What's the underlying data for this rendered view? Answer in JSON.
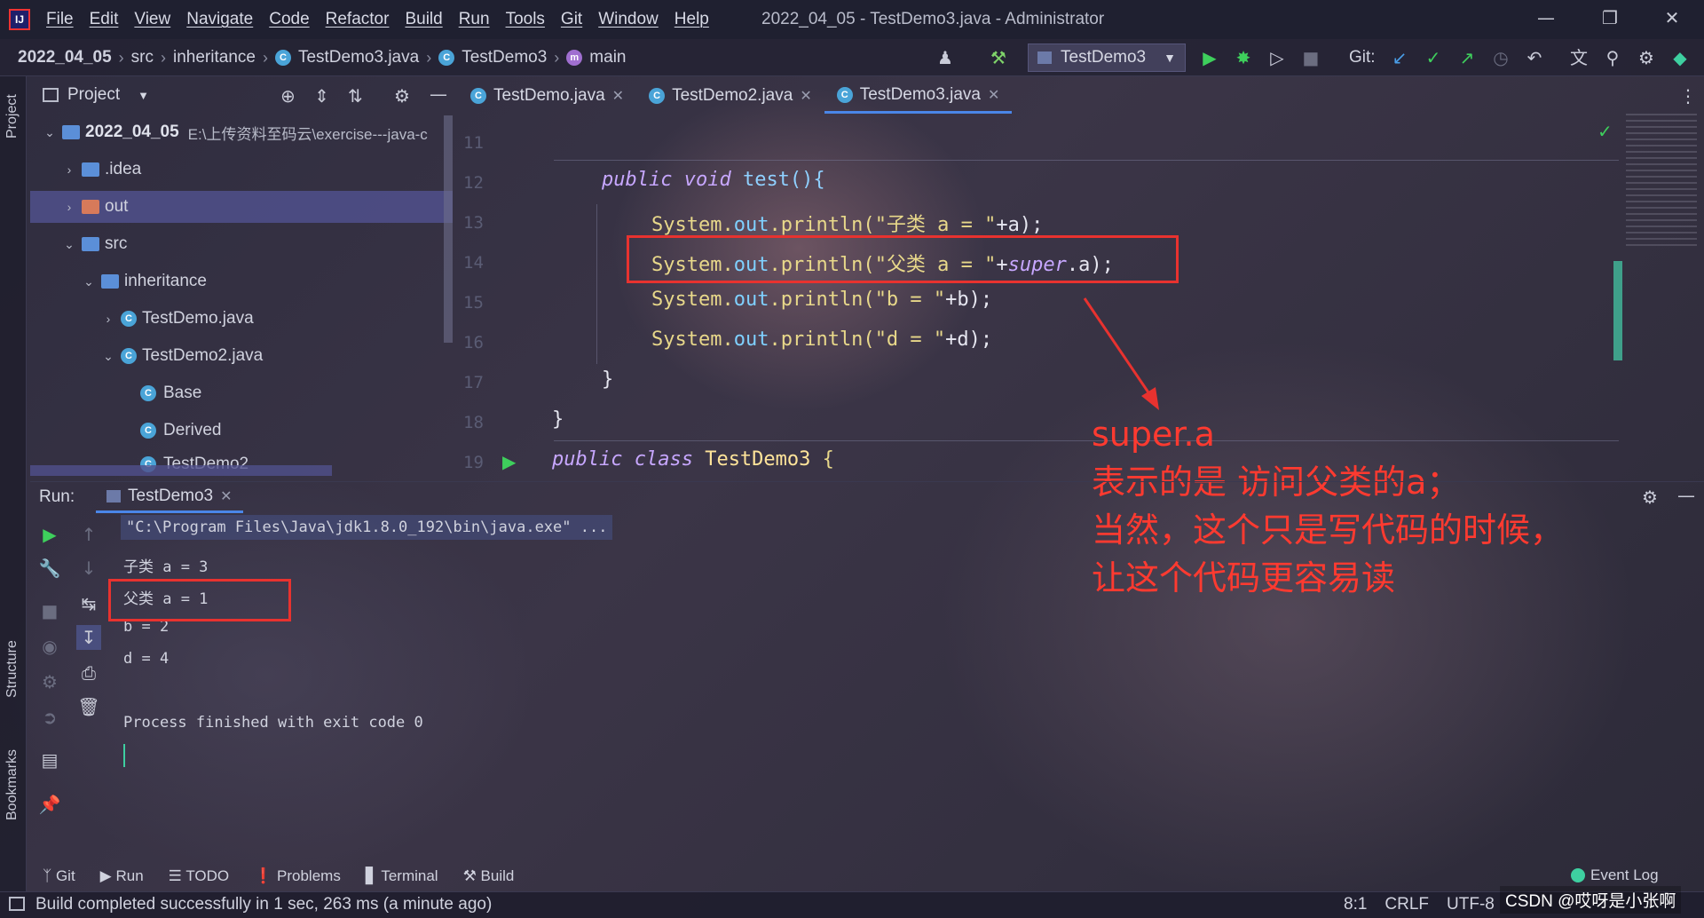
{
  "app": {
    "window_title": "2022_04_05 - TestDemo3.java - Administrator",
    "menu": [
      "File",
      "Edit",
      "View",
      "Navigate",
      "Code",
      "Refactor",
      "Build",
      "Run",
      "Tools",
      "Git",
      "Window",
      "Help"
    ]
  },
  "breadcrumb": [
    "2022_04_05",
    "src",
    "inheritance",
    "TestDemo3.java",
    "TestDemo3",
    "main"
  ],
  "toolbar": {
    "run_config": "TestDemo3",
    "git_label": "Git:"
  },
  "left_stripe": {
    "project": "Project",
    "structure": "Structure",
    "bookmarks": "Bookmarks"
  },
  "project_panel": {
    "title": "Project",
    "tree": [
      {
        "label": "2022_04_05",
        "path": "E:\\上传资料至码云\\exercise---java-c",
        "depth": 0,
        "expanded": true
      },
      {
        "label": ".idea",
        "depth": 1,
        "expanded": false
      },
      {
        "label": "out",
        "depth": 1,
        "expanded": false,
        "selected": true
      },
      {
        "label": "src",
        "depth": 1,
        "expanded": true
      },
      {
        "label": "inheritance",
        "depth": 2,
        "expanded": true
      },
      {
        "label": "TestDemo.java",
        "depth": 3,
        "expanded": false
      },
      {
        "label": "TestDemo2.java",
        "depth": 3,
        "expanded": true
      },
      {
        "label": "Base",
        "depth": 4
      },
      {
        "label": "Derived",
        "depth": 4
      },
      {
        "label": "TestDemo2",
        "depth": 4
      }
    ]
  },
  "editor": {
    "tabs": [
      {
        "label": "TestDemo.java",
        "active": false
      },
      {
        "label": "TestDemo2.java",
        "active": false
      },
      {
        "label": "TestDemo3.java",
        "active": true
      }
    ],
    "line_numbers": [
      "11",
      "12",
      "13",
      "14",
      "15",
      "16",
      "17",
      "18",
      "19"
    ],
    "lines": {
      "l12_kw": "public void",
      "l12_rest": " test(){",
      "l13_a": "System.",
      "l13_b": "out",
      "l13_c": ".println(",
      "l13_str": "\"子类 a = \"",
      "l13_tail": "+a);",
      "l14_str": "\"父类 a = \"",
      "l14_plus": "+",
      "l14_super": "super",
      "l14_tail": ".a);",
      "l15_str": "\"b = \"",
      "l15_tail": "+b);",
      "l16_str": "\"d = \"",
      "l16_tail": "+d);",
      "l17": "}",
      "l18": "}",
      "l19_kw": "public class",
      "l19_cls": " TestDemo3 ",
      "l19_brace": "{"
    }
  },
  "annotation": {
    "line1": "super.a",
    "line2": "表示的是 访问父类的a；",
    "line3": "当然，这个只是写代码的时候，",
    "line4": "让这个代码更容易读"
  },
  "run_panel": {
    "label": "Run:",
    "tab": "TestDemo3",
    "command": "\"C:\\Program Files\\Java\\jdk1.8.0_192\\bin\\java.exe\" ...",
    "output": [
      "子类 a = 3",
      "父类 a = 1",
      "b = 2",
      "d = 4"
    ],
    "exit": "Process finished with exit code 0"
  },
  "bottom_tools": [
    "Git",
    "Run",
    "TODO",
    "Problems",
    "Terminal",
    "Build"
  ],
  "event_log": "Event Log",
  "status": {
    "message": "Build completed successfully in 1 sec, 263 ms (a minute ago)",
    "position": "8:1",
    "line_sep": "CRLF",
    "encoding": "UTF-8"
  },
  "watermark": "CSDN @哎呀是小张啊",
  "colors": {
    "accent": "#4a86e8",
    "annotation_red": "#ff3a30",
    "run_green": "#3ecf5c"
  }
}
